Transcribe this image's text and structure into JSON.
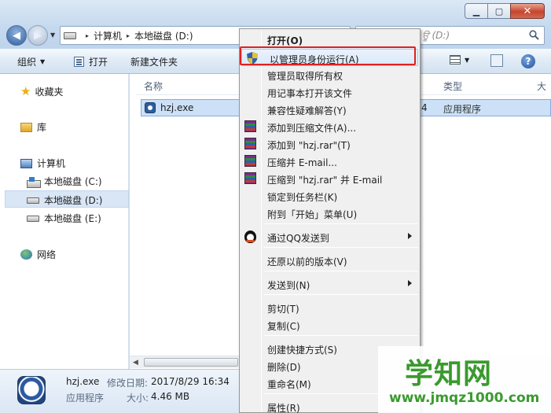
{
  "window": {
    "close_glyph": "✕",
    "minimize_glyph": "▁",
    "maximize_glyph": "▢"
  },
  "address": {
    "chevron": "▸",
    "crumbs": [
      "计算机",
      "本地磁盘 (D:)"
    ]
  },
  "search": {
    "placeholder_fragment": "ਊ (D:)"
  },
  "toolbar": {
    "organize_label": "组织",
    "open_label": "打开",
    "new_folder_label": "新建文件夹"
  },
  "nav": {
    "favorites": "收藏夹",
    "libraries": "库",
    "computer": "计算机",
    "drive_c": "本地磁盘 (C:)",
    "drive_d": "本地磁盘 (D:)",
    "drive_e": "本地磁盘 (E:)",
    "network": "网络"
  },
  "columns": {
    "name": "名称",
    "type": "类型",
    "size_fragment": "大"
  },
  "file": {
    "name": "hzj.exe",
    "type": "应用程序",
    "col_fragment": "4"
  },
  "details": {
    "name": "hzj.exe",
    "type": "应用程序",
    "modified_label": "修改日期:",
    "modified_value": "2017/8/29 16:34",
    "size_label": "大小:",
    "size_value": "4.46 MB"
  },
  "context_menu": {
    "open": "打开(O)",
    "run_as_admin": "以管理员身份运行(A)",
    "take_ownership": "管理员取得所有权",
    "open_with_notepad": "用记事本打开该文件",
    "troubleshoot": "兼容性疑难解答(Y)",
    "add_to_archive": "添加到压缩文件(A)...",
    "add_to_rar": "添加到 \"hzj.rar\"(T)",
    "compress_email": "压缩并 E-mail...",
    "compress_rar_email": "压缩到 \"hzj.rar\" 并 E-mail",
    "pin_taskbar": "锁定到任务栏(K)",
    "pin_start": "附到「开始」菜单(U)",
    "send_qq": "通过QQ发送到",
    "restore_versions": "还原以前的版本(V)",
    "send_to": "发送到(N)",
    "cut": "剪切(T)",
    "copy": "复制(C)",
    "create_shortcut": "创建快捷方式(S)",
    "delete": "删除(D)",
    "rename": "重命名(M)",
    "properties": "属性(R)"
  },
  "watermark": {
    "title": "学知网",
    "url": "www.jmqz1000.com"
  }
}
